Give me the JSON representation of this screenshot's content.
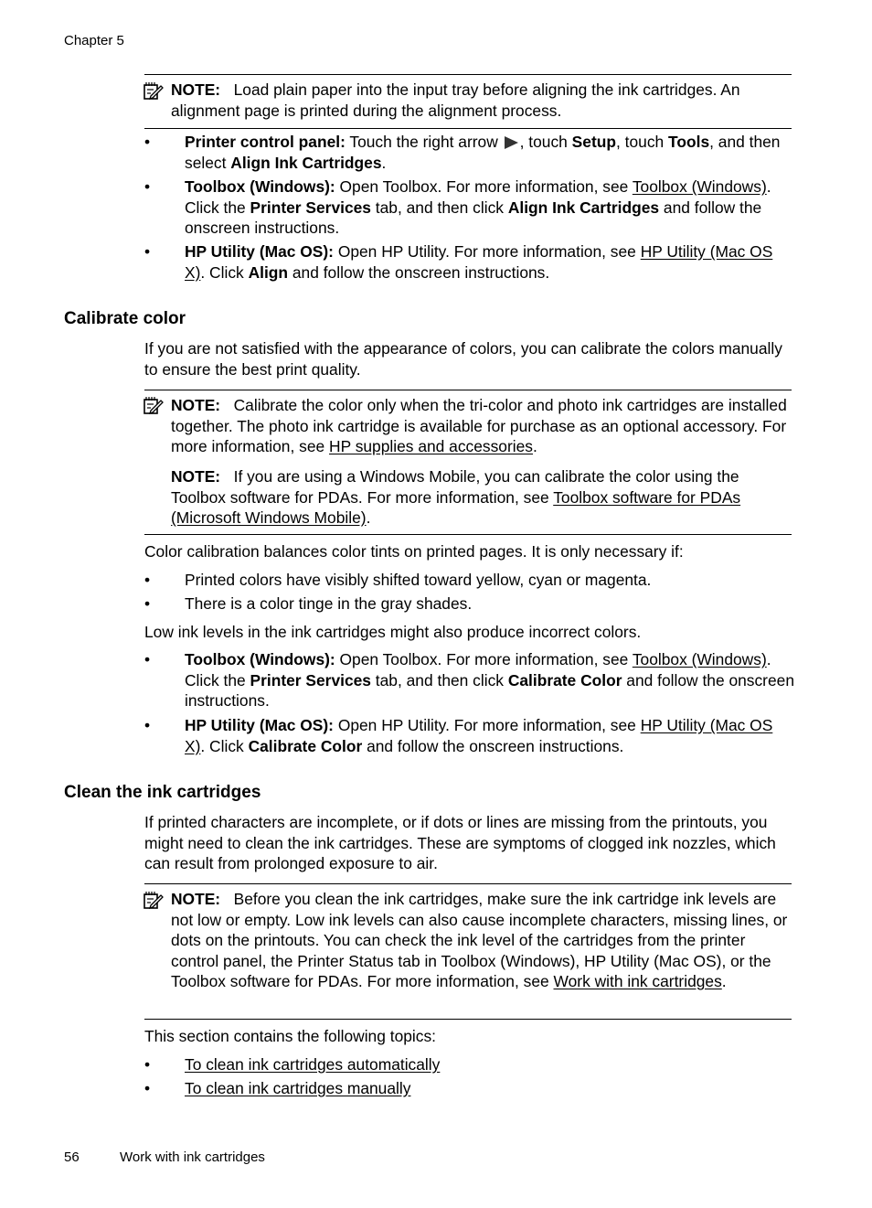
{
  "header": {
    "chapter": "Chapter 5"
  },
  "note_label": "NOTE:",
  "align_section": {
    "note1": "Load plain paper into the input tray before aligning the ink cartridges. An alignment page is printed during the alignment process.",
    "bullets": [
      {
        "bold": "Printer control panel:",
        "t1": " Touch the right arrow ",
        "icon": "right-arrow-icon",
        "t2": ", touch ",
        "b2": "Setup",
        "t3": ", touch ",
        "b3": "Tools",
        "t4": ", and then select ",
        "b4": "Align Ink Cartridges",
        "t5": "."
      },
      {
        "bold": "Toolbox (Windows):",
        "t1": " Open Toolbox. For more information, see ",
        "link": "Toolbox (Windows)",
        "t2": ". Click the ",
        "b2": "Printer Services",
        "t3": " tab, and then click ",
        "b3": "Align Ink Cartridges",
        "t4": " and follow the onscreen instructions."
      },
      {
        "bold": "HP Utility (Mac OS):",
        "t1": " Open HP Utility. For more information, see ",
        "link": "HP Utility (Mac OS X)",
        "t2": ". Click ",
        "b2": "Align",
        "t3": " and follow the onscreen instructions."
      }
    ]
  },
  "calibrate_section": {
    "title": "Calibrate color",
    "intro": "If you are not satisfied with the appearance of colors, you can calibrate the colors manually to ensure the best print quality.",
    "note1_text": "Calibrate the color only when the tri-color and photo ink cartridges are installed together. The photo ink cartridge is available for purchase as an optional accessory. For more information, see ",
    "note1_link": "HP supplies and accessories",
    "note2_text": "If you are using a Windows Mobile, you can calibrate the color using the Toolbox software for PDAs. For more information, see ",
    "note2_link": "Toolbox software for PDAs (Microsoft Windows Mobile)",
    "balance_text": "Color calibration balances color tints on printed pages. It is only necessary if:",
    "conditions": [
      "Printed colors have visibly shifted toward yellow, cyan or magenta.",
      "There is a color tinge in the gray shades."
    ],
    "low_ink_text": "Low ink levels in the ink cartridges might also produce incorrect colors.",
    "bullets": [
      {
        "bold": "Toolbox (Windows):",
        "t1": " Open Toolbox. For more information, see ",
        "link": "Toolbox (Windows)",
        "t2": ". Click the ",
        "b2": "Printer Services",
        "t3": " tab, and then click ",
        "b3": "Calibrate Color",
        "t4": " and follow the onscreen instructions."
      },
      {
        "bold": "HP Utility (Mac OS):",
        "t1": " Open HP Utility. For more information, see ",
        "link": "HP Utility (Mac OS X)",
        "t2": ". Click ",
        "b2": "Calibrate Color",
        "t3": " and follow the onscreen instructions."
      }
    ]
  },
  "clean_section": {
    "title": "Clean the ink cartridges",
    "intro": "If printed characters are incomplete, or if dots or lines are missing from the printouts, you might need to clean the ink cartridges. These are symptoms of clogged ink nozzles, which can result from prolonged exposure to air.",
    "note_text": "Before you clean the ink cartridges, make sure the ink cartridge ink levels are not low or empty. Low ink levels can also cause incomplete characters, missing lines, or dots on the printouts. You can check the ink level of the cartridges from the printer control panel, the Printer Status tab in Toolbox (Windows), HP Utility (Mac OS), or the Toolbox software for PDAs. For more information, see ",
    "note_link": "Work with ink cartridges",
    "topics_intro": "This section contains the following topics:",
    "topics": [
      "To clean ink cartridges automatically",
      "To clean ink cartridges manually"
    ]
  },
  "footer": {
    "page_number": "56",
    "title": "Work with ink cartridges"
  },
  "bullet_char": "•",
  "period": "."
}
